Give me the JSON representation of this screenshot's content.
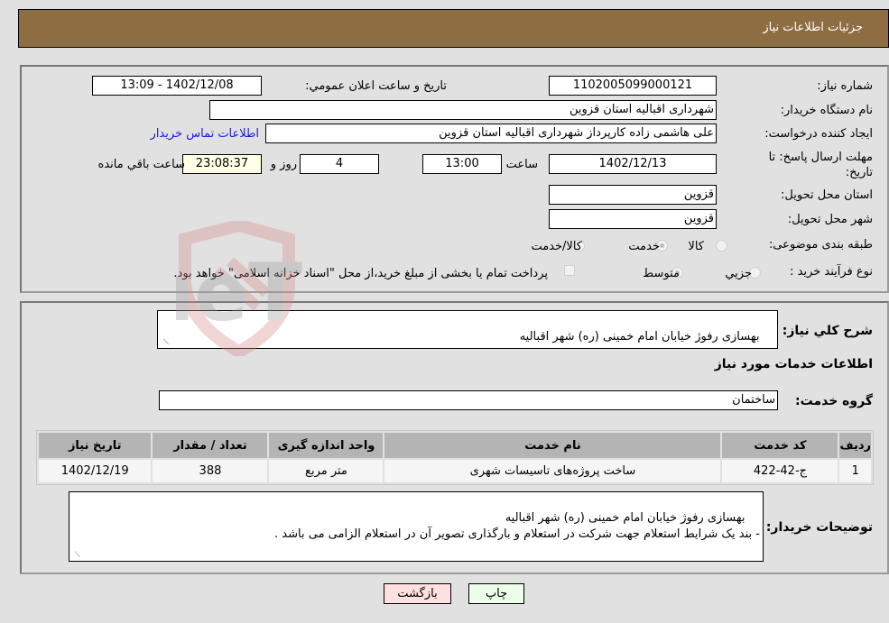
{
  "header": {
    "title": "جزئیات اطلاعات نیاز"
  },
  "details": {
    "need_number_label": "شماره نیاز:",
    "need_number": "1102005099000121",
    "announce_label": "تاريخ و ساعت اعلان عمومي:",
    "announce_value": "1402/12/08 - 13:09",
    "buyer_org_label": "نام دستگاه خریدار:",
    "buyer_org": "شهرداری اقبالیه استان قزوین",
    "requester_label": "ایجاد کننده درخواست:",
    "requester": "علی هاشمی زاده کارپرداز شهرداری اقبالیه استان قزوین",
    "contact_link": "اطلاعات تماس خریدار",
    "deadline_label": "مهلت ارسال پاسخ: تا تاریخ:",
    "deadline_date": "1402/12/13",
    "time_label": "ساعت",
    "deadline_time": "13:00",
    "days_value": "4",
    "days_label": "روز و",
    "remaining_time": "23:08:37",
    "remaining_label": "ساعت باقي مانده",
    "province_label": "استان محل تحویل:",
    "province": "قزوین",
    "city_label": "شهر محل تحویل:",
    "city": "قزوین",
    "category_label": "طبقه بندی موضوعی:",
    "category_options": [
      {
        "label": "کالا",
        "selected": false
      },
      {
        "label": "خدمت",
        "selected": true
      },
      {
        "label": "کالا/خدمت",
        "selected": false
      }
    ],
    "process_label": "نوع فرآیند خرید :",
    "process_options": [
      {
        "label": "جزيي",
        "selected": false
      },
      {
        "label": "متوسط",
        "selected": true
      }
    ],
    "treasury_note": "پرداخت تمام یا بخشی از مبلغ خرید،از محل \"اسناد خزانه اسلامی\" خواهد بود.",
    "treasury_checked": false
  },
  "services": {
    "description_label": "شرح كلي نياز:",
    "description": "بهسازی رفوژ خیابان امام خمینی (ره) شهر اقبالیه",
    "section_title": "اطلاعات خدمات مورد نیاز",
    "group_label": "گروه خدمت:",
    "group": "ساختمان",
    "table": {
      "headers": [
        "ردیف",
        "کد خدمت",
        "نام خدمت",
        "واحد اندازه گیری",
        "تعداد / مقدار",
        "تاریخ نیاز"
      ],
      "rows": [
        [
          "1",
          "ج-42-422",
          "ساخت پروژه‌های تاسیسات شهری",
          "متر مربع",
          "388",
          "1402/12/19"
        ]
      ]
    },
    "buyer_notes_label": "توضیحات خریدار:",
    "buyer_notes": "بهسازی رفوژ خیابان امام خمینی (ره) شهر اقبالیه\n- بند یک شرایط استعلام جهت شرکت در استعلام و بارگذاری تصویر آن در استعلام الزامی می باشد ."
  },
  "buttons": {
    "print": "چاپ",
    "back": "بازگشت"
  },
  "watermark": {
    "text": "AriaTender.neT"
  },
  "colors": {
    "header_bg": "#8e6d43",
    "back_bg": "#ffe0e0",
    "print_bg": "#ecffe8",
    "link": "#1a1ad6"
  }
}
